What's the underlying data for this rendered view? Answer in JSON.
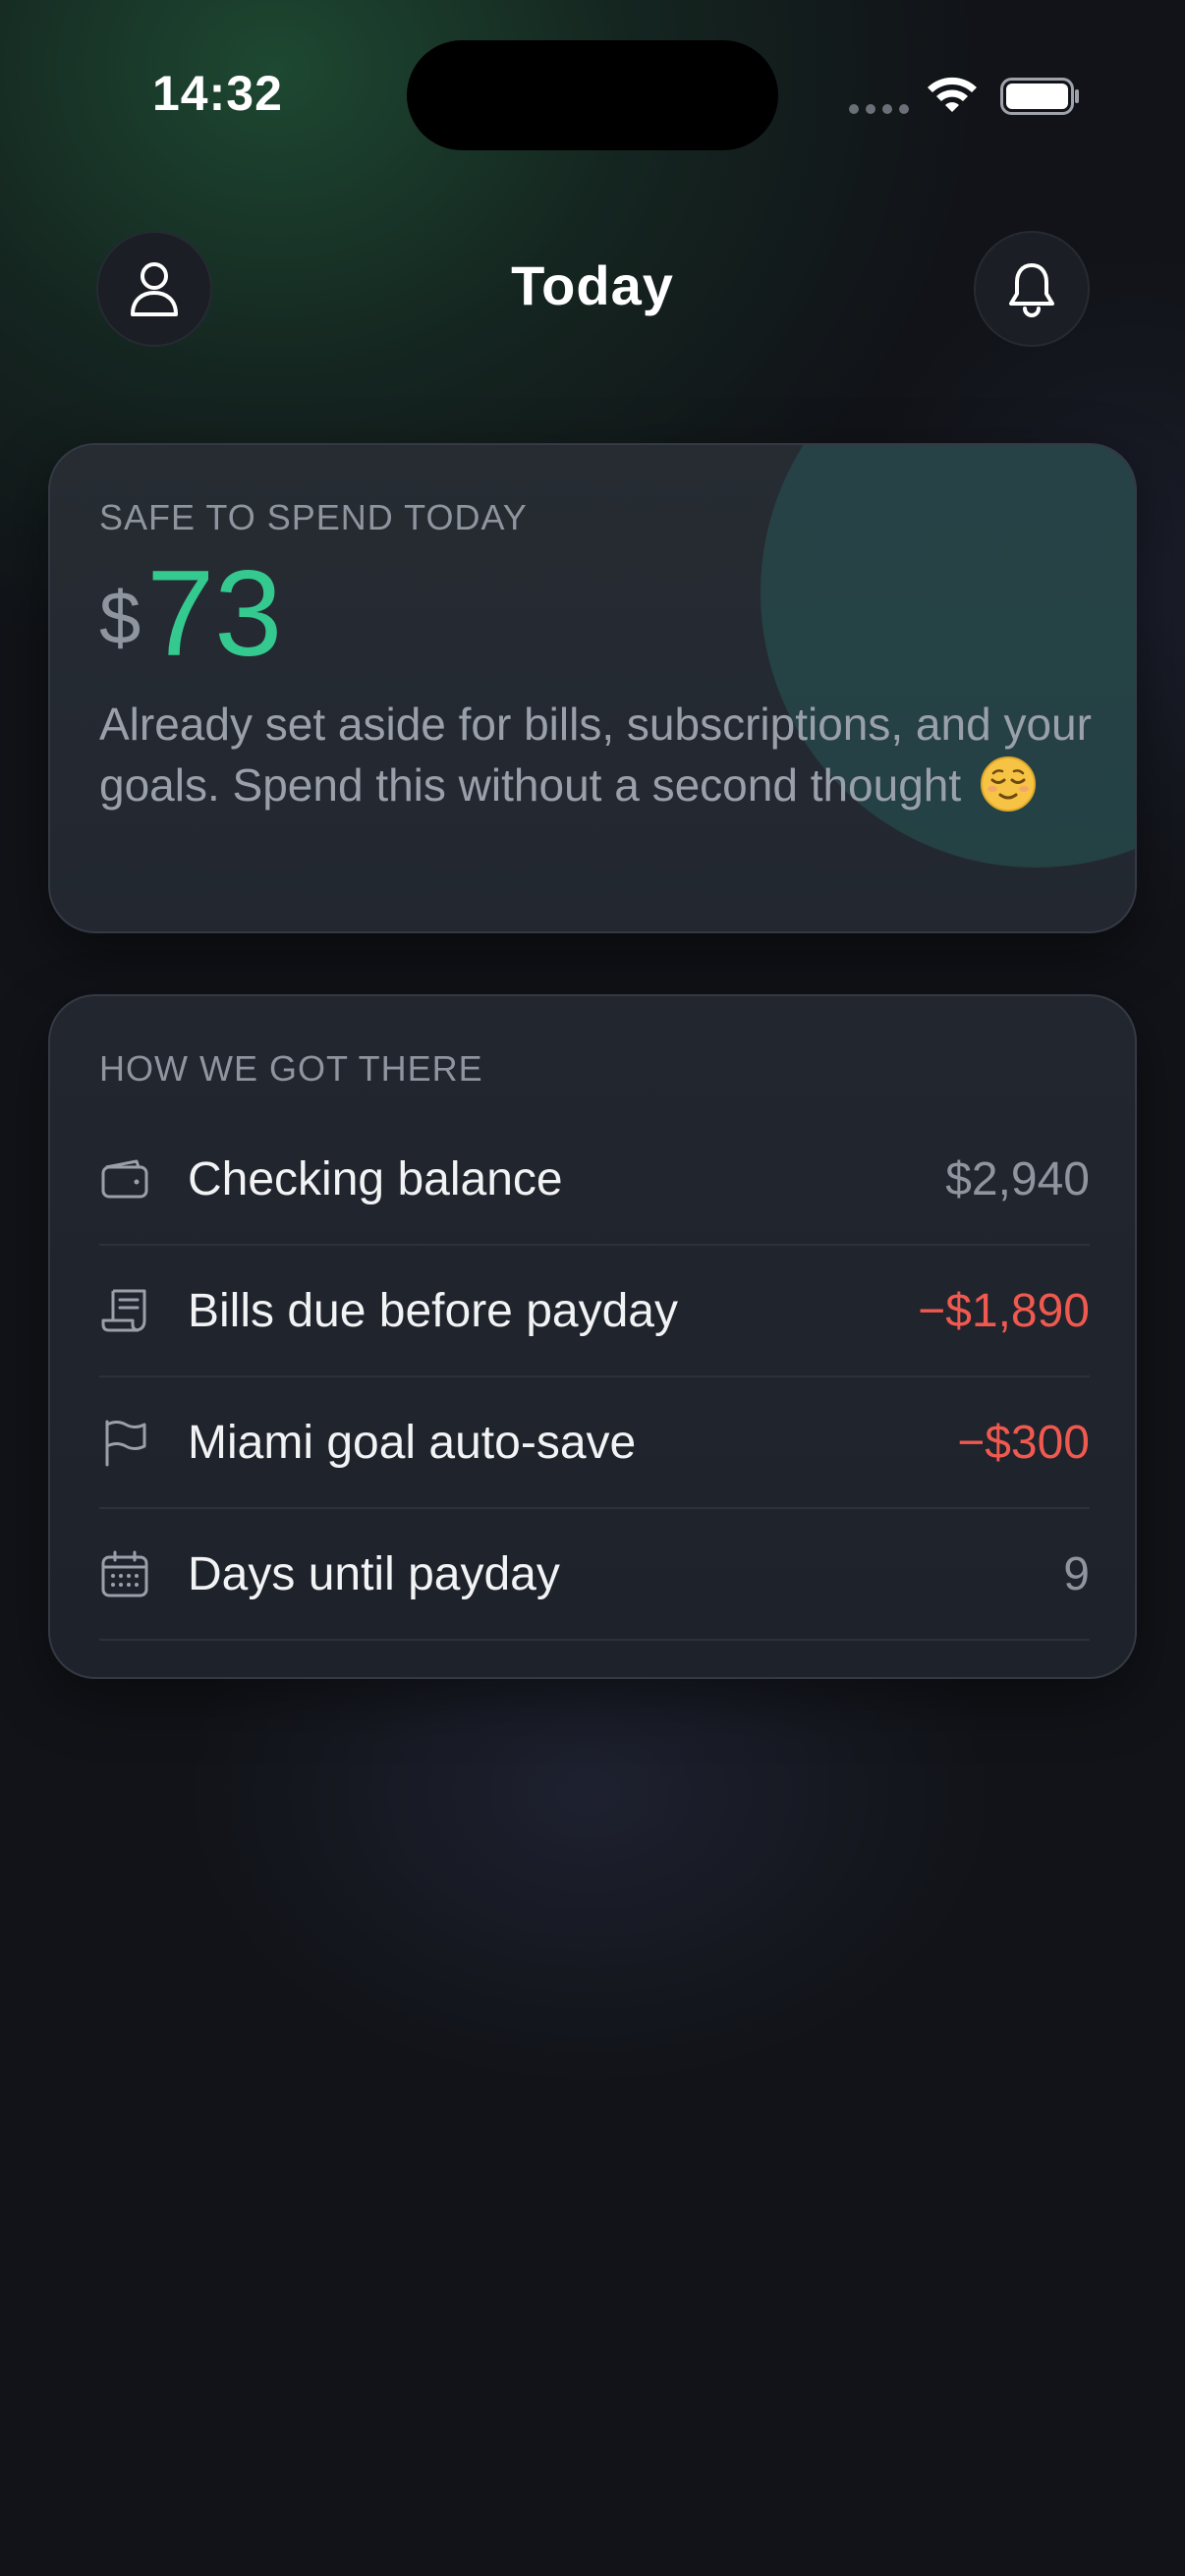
{
  "status_bar": {
    "time": "14:32"
  },
  "header": {
    "title": "Today",
    "profile_icon": "person-icon",
    "bell_icon": "bell-icon"
  },
  "safe_card": {
    "label": "SAFE TO SPEND TODAY",
    "currency": "$",
    "amount": "73",
    "description": "Already set aside for bills, subscriptions, and your goals. Spend this without a second thought",
    "emoji_icon": "relieved-face-icon",
    "accent_color": "#34c98e"
  },
  "breakdown_card": {
    "label": "HOW WE GOT THERE",
    "rows": [
      {
        "icon": "wallet-icon",
        "label": "Checking balance",
        "value": "$2,940",
        "negative": false
      },
      {
        "icon": "receipt-icon",
        "label": "Bills due before payday",
        "value": "−$1,890",
        "negative": true
      },
      {
        "icon": "flag-icon",
        "label": "Miami goal auto-save",
        "value": "−$300",
        "negative": true
      },
      {
        "icon": "calendar-icon",
        "label": "Days until payday",
        "value": "9",
        "negative": false
      }
    ],
    "negative_color": "#f0594f"
  }
}
